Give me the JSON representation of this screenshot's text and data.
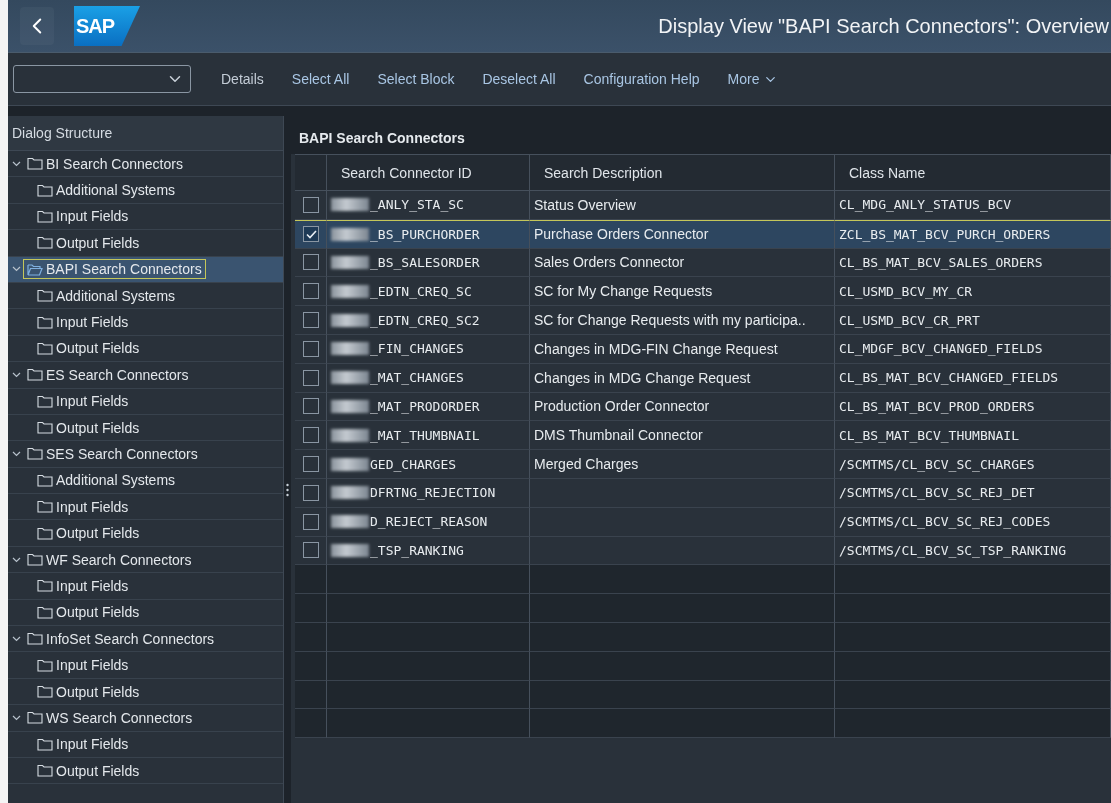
{
  "header": {
    "logo": "SAP",
    "title": "Display View \"BAPI Search Connectors\": Overview"
  },
  "toolbar": {
    "buttons": [
      "Details",
      "Select All",
      "Select Block",
      "Deselect All",
      "Configuration Help"
    ],
    "more": "More"
  },
  "dialog_structure": {
    "title": "Dialog Structure",
    "items": [
      {
        "label": "BI Search Connectors",
        "selected": false,
        "expanded": true,
        "children": [
          {
            "label": "Additional Systems",
            "selected": false
          },
          {
            "label": "Input Fields",
            "selected": false
          },
          {
            "label": "Output Fields",
            "selected": false
          }
        ]
      },
      {
        "label": "BAPI Search Connectors",
        "selected": true,
        "expanded": true,
        "children": [
          {
            "label": "Additional Systems",
            "selected": false
          },
          {
            "label": "Input Fields",
            "selected": false
          },
          {
            "label": "Output Fields",
            "selected": false
          }
        ]
      },
      {
        "label": "ES Search Connectors",
        "selected": false,
        "expanded": true,
        "children": [
          {
            "label": "Input Fields",
            "selected": false
          },
          {
            "label": "Output Fields",
            "selected": false
          }
        ]
      },
      {
        "label": "SES Search Connectors",
        "selected": false,
        "expanded": true,
        "children": [
          {
            "label": "Additional Systems",
            "selected": false
          },
          {
            "label": "Input Fields",
            "selected": false
          },
          {
            "label": "Output Fields",
            "selected": false
          }
        ]
      },
      {
        "label": "WF Search Connectors",
        "selected": false,
        "expanded": true,
        "children": [
          {
            "label": "Input Fields",
            "selected": false
          },
          {
            "label": "Output Fields",
            "selected": false
          }
        ]
      },
      {
        "label": "InfoSet Search Connectors",
        "selected": false,
        "expanded": true,
        "children": [
          {
            "label": "Input Fields",
            "selected": false
          },
          {
            "label": "Output Fields",
            "selected": false
          }
        ]
      },
      {
        "label": "WS Search Connectors",
        "selected": false,
        "expanded": true,
        "children": [
          {
            "label": "Input Fields",
            "selected": false
          },
          {
            "label": "Output Fields",
            "selected": false
          }
        ]
      }
    ]
  },
  "table": {
    "title": "BAPI Search Connectors",
    "columns": [
      "Search Connector ID",
      "Search Description",
      "Class Name"
    ],
    "rows": [
      {
        "checked": false,
        "selected": false,
        "id": "_ANLY_STA_SC",
        "description": "Status Overview",
        "class_name": "CL_MDG_ANLY_STATUS_BCV"
      },
      {
        "checked": true,
        "selected": true,
        "id": "_BS_PURCHORDER",
        "description": "Purchase Orders Connector",
        "class_name": "ZCL_BS_MAT_BCV_PURCH_ORDERS"
      },
      {
        "checked": false,
        "selected": false,
        "id": "_BS_SALESORDER",
        "description": "Sales Orders Connector",
        "class_name": "CL_BS_MAT_BCV_SALES_ORDERS"
      },
      {
        "checked": false,
        "selected": false,
        "id": "_EDTN_CREQ_SC",
        "description": "SC for My Change Requests",
        "class_name": "CL_USMD_BCV_MY_CR"
      },
      {
        "checked": false,
        "selected": false,
        "id": "_EDTN_CREQ_SC2",
        "description": "SC for Change Requests with my participa..",
        "class_name": "CL_USMD_BCV_CR_PRT"
      },
      {
        "checked": false,
        "selected": false,
        "id": "_FIN_CHANGES",
        "description": "Changes in MDG-FIN Change Request",
        "class_name": "CL_MDGF_BCV_CHANGED_FIELDS"
      },
      {
        "checked": false,
        "selected": false,
        "id": "_MAT_CHANGES",
        "description": "Changes in MDG Change Request",
        "class_name": "CL_BS_MAT_BCV_CHANGED_FIELDS"
      },
      {
        "checked": false,
        "selected": false,
        "id": "_MAT_PRODORDER",
        "description": "Production Order Connector",
        "class_name": "CL_BS_MAT_BCV_PROD_ORDERS"
      },
      {
        "checked": false,
        "selected": false,
        "id": "_MAT_THUMBNAIL",
        "description": "DMS Thumbnail Connector",
        "class_name": "CL_BS_MAT_BCV_THUMBNAIL"
      },
      {
        "checked": false,
        "selected": false,
        "id": "GED_CHARGES",
        "description": "Merged Charges",
        "class_name": "/SCMTMS/CL_BCV_SC_CHARGES"
      },
      {
        "checked": false,
        "selected": false,
        "id": "DFRTNG_REJECTION",
        "class_name": "/SCMTMS/CL_BCV_SC_REJ_DET"
      },
      {
        "checked": false,
        "selected": false,
        "id": "D_REJECT_REASON",
        "class_name": "/SCMTMS/CL_BCV_SC_REJ_CODES"
      },
      {
        "checked": false,
        "selected": false,
        "id": "_TSP_RANKING",
        "class_name": "/SCMTMS/CL_BCV_SC_TSP_RANKING"
      }
    ]
  }
}
